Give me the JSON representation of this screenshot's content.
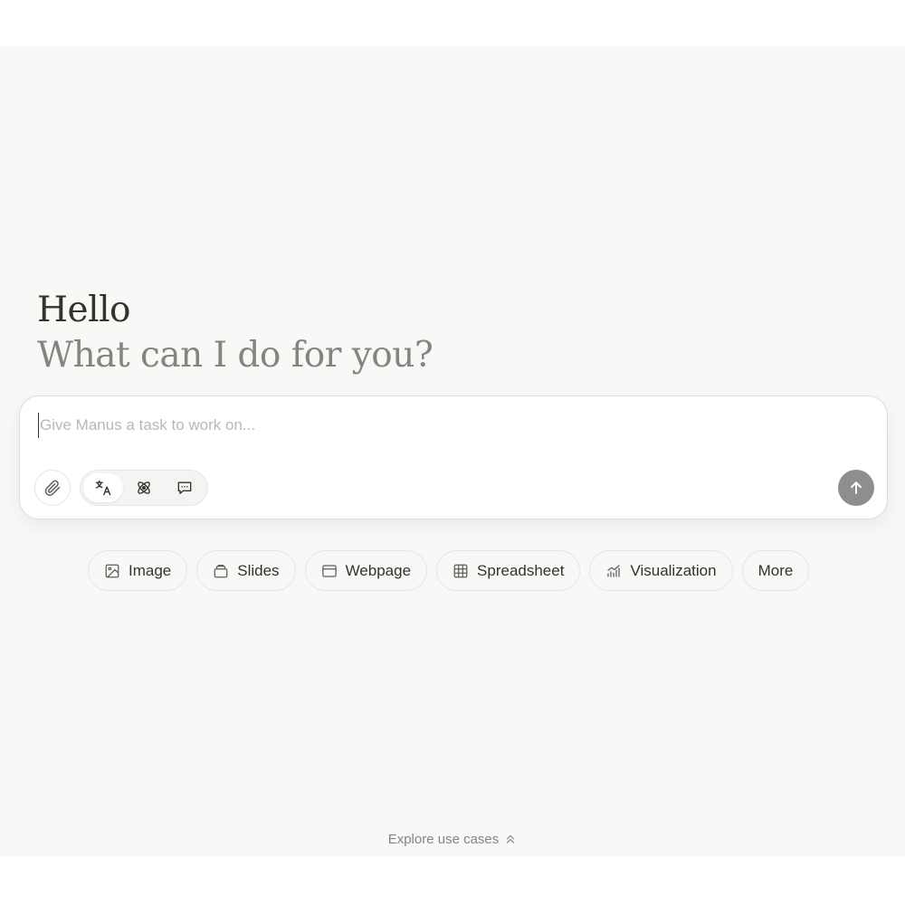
{
  "greeting": {
    "title": "Hello",
    "subtitle": "What can I do for you?"
  },
  "composer": {
    "placeholder": "Give Manus a task to work on...",
    "value": "",
    "attach_icon": "paperclip-icon",
    "modes": [
      {
        "icon": "agent-mode-icon",
        "active": true
      },
      {
        "icon": "atom-icon",
        "active": false
      },
      {
        "icon": "chat-bubble-icon",
        "active": false
      }
    ],
    "send_icon": "arrow-up-icon"
  },
  "chips": [
    {
      "label": "Image",
      "icon": "image-icon"
    },
    {
      "label": "Slides",
      "icon": "slides-icon"
    },
    {
      "label": "Webpage",
      "icon": "browser-window-icon"
    },
    {
      "label": "Spreadsheet",
      "icon": "table-grid-icon"
    },
    {
      "label": "Visualization",
      "icon": "bar-chart-icon"
    },
    {
      "label": "More",
      "icon": ""
    }
  ],
  "footer": {
    "explore_label": "Explore use cases",
    "explore_icon": "double-chevron-up-icon"
  },
  "colors": {
    "background": "#f8f8f7",
    "text_primary": "#34322d",
    "text_secondary": "#858481",
    "send_button": "#8e8e8c"
  }
}
